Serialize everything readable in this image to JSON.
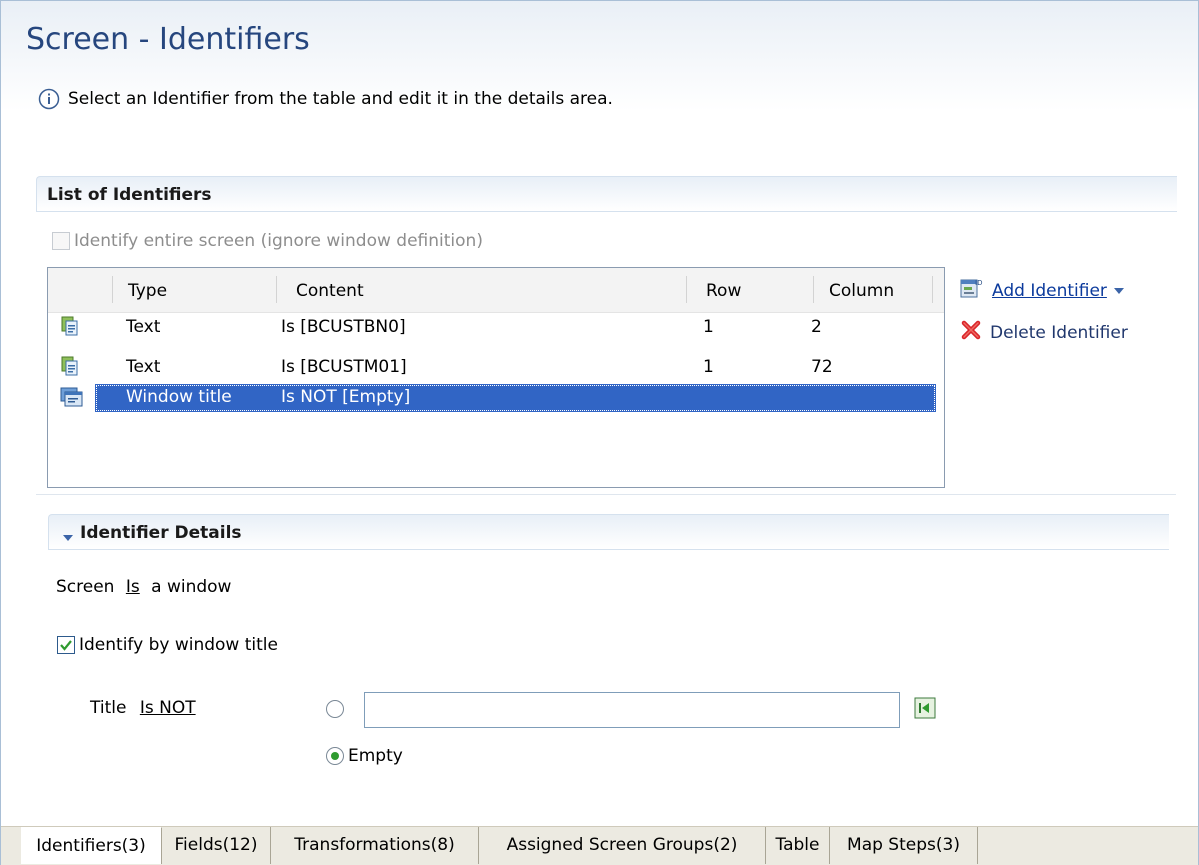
{
  "page": {
    "title": "Screen - Identifiers",
    "info": "Select an Identifier from the table and edit it in the details area."
  },
  "identifiers_section": {
    "title": "List of Identifiers",
    "entire_screen_label": "Identify entire screen (ignore window definition)",
    "entire_screen_checked": false
  },
  "table": {
    "columns": [
      "Type",
      "Content",
      "Row",
      "Column"
    ],
    "rows": [
      {
        "type": "Text",
        "content": "Is [BCUSTBN0]",
        "row": "1",
        "column": "2",
        "icon": "text-identifier-icon",
        "selected": false
      },
      {
        "type": "Text",
        "content": "Is [BCUSTM01]",
        "row": "1",
        "column": "72",
        "icon": "text-identifier-icon",
        "selected": false
      },
      {
        "type": "Window title",
        "content": "Is NOT [Empty]",
        "row": "",
        "column": "",
        "icon": "window-title-icon",
        "selected": true
      }
    ]
  },
  "actions": {
    "add": "Add Identifier",
    "delete": "Delete Identifier"
  },
  "details": {
    "title": "Identifier Details",
    "screen_prefix": "Screen",
    "screen_operator": "Is",
    "screen_suffix": "a window",
    "identify_title_label": "Identify by window title",
    "identify_title_checked": true,
    "title_label": "Title",
    "title_operator": "Is NOT",
    "title_value": "",
    "empty_label": "Empty",
    "empty_selected": true
  },
  "tabs": [
    {
      "label": "Identifiers(3)",
      "active": true
    },
    {
      "label": "Fields(12)",
      "active": false
    },
    {
      "label": "Transformations(8)",
      "active": false
    },
    {
      "label": "Assigned Screen Groups(2)",
      "active": false
    },
    {
      "label": "Table",
      "active": false
    },
    {
      "label": "Map Steps(3)",
      "active": false
    }
  ],
  "colors": {
    "title": "#26467e",
    "selection": "#3165c5",
    "link": "#0b3a9c",
    "delete": "#d9252a"
  }
}
